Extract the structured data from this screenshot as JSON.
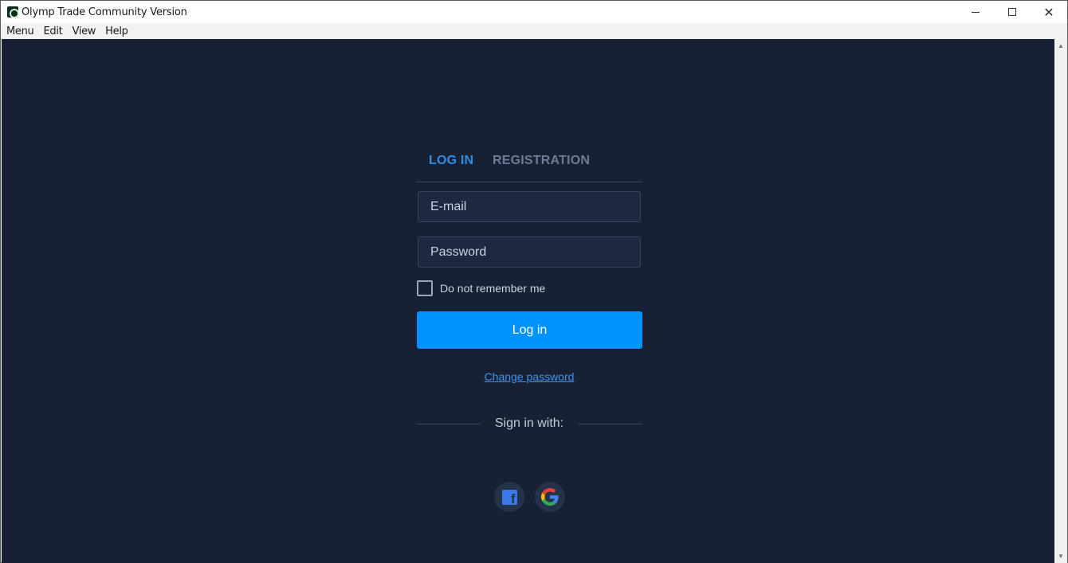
{
  "window": {
    "title": "Olymp Trade Community Version",
    "controls": {
      "minimize": "minimize",
      "maximize": "maximize",
      "close": "✕"
    }
  },
  "menubar": {
    "items": [
      {
        "label": "Menu"
      },
      {
        "label": "Edit"
      },
      {
        "label": "View"
      },
      {
        "label": "Help"
      }
    ]
  },
  "auth": {
    "tabs": [
      {
        "label": "LOG IN",
        "active": true
      },
      {
        "label": "REGISTRATION",
        "active": false
      }
    ],
    "email": {
      "placeholder": "E-mail",
      "value": ""
    },
    "password": {
      "placeholder": "Password",
      "value": ""
    },
    "remember": {
      "label": "Do not remember me",
      "checked": false
    },
    "login_button": "Log in",
    "change_password": "Change password",
    "sign_in_with": "Sign in with:",
    "social": [
      {
        "name": "facebook-icon"
      },
      {
        "name": "google-icon"
      }
    ]
  },
  "colors": {
    "background": "#172133",
    "accent": "#0093ff",
    "active_tab": "#2c8fe8",
    "inactive_tab": "#6a7c98",
    "link": "#3d95f0"
  }
}
